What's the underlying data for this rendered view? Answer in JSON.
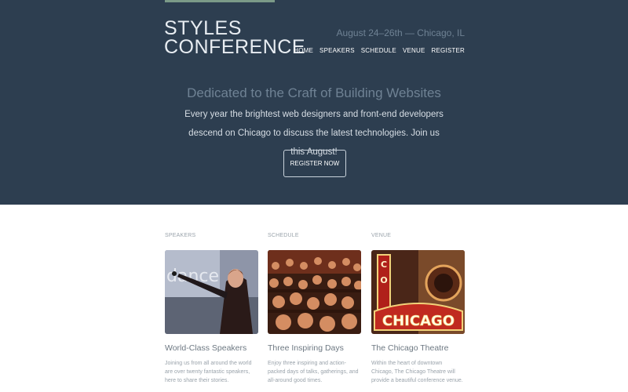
{
  "header": {
    "logo_line1": "STYLES",
    "logo_line2": "CONFERENCE",
    "tagline": "August 24–26th — Chicago, IL",
    "nav": [
      "HOME",
      "SPEAKERS",
      "SCHEDULE",
      "VENUE",
      "REGISTER"
    ]
  },
  "hero": {
    "heading": "Dedicated to the Craft of Building Websites",
    "text": "Every year the brightest web designers and front-end developers descend on Chicago to discuss the latest technologies. Join us this August!",
    "cta": "REGISTER NOW"
  },
  "teasers": [
    {
      "label": "SPEAKERS",
      "title": "World-Class Speakers",
      "text": "Joining us from all around the world are over twenty fantastic speakers, here to share their stories."
    },
    {
      "label": "SCHEDULE",
      "title": "Three Inspiring Days",
      "text": "Enjoy three inspiring and action-packed days of talks, gatherings, and all-around good times."
    },
    {
      "label": "VENUE",
      "title": "The Chicago Theatre",
      "text": "Within the heart of downtown Chicago, The Chicago Theatre will provide a beautiful conference venue."
    }
  ],
  "images": {
    "speaker_screen_text": "dance",
    "venue_sign_text": "CHICAGO"
  },
  "colors": {
    "hero_bg": "#2d3e50",
    "accent_bar": "#7b9a88"
  }
}
